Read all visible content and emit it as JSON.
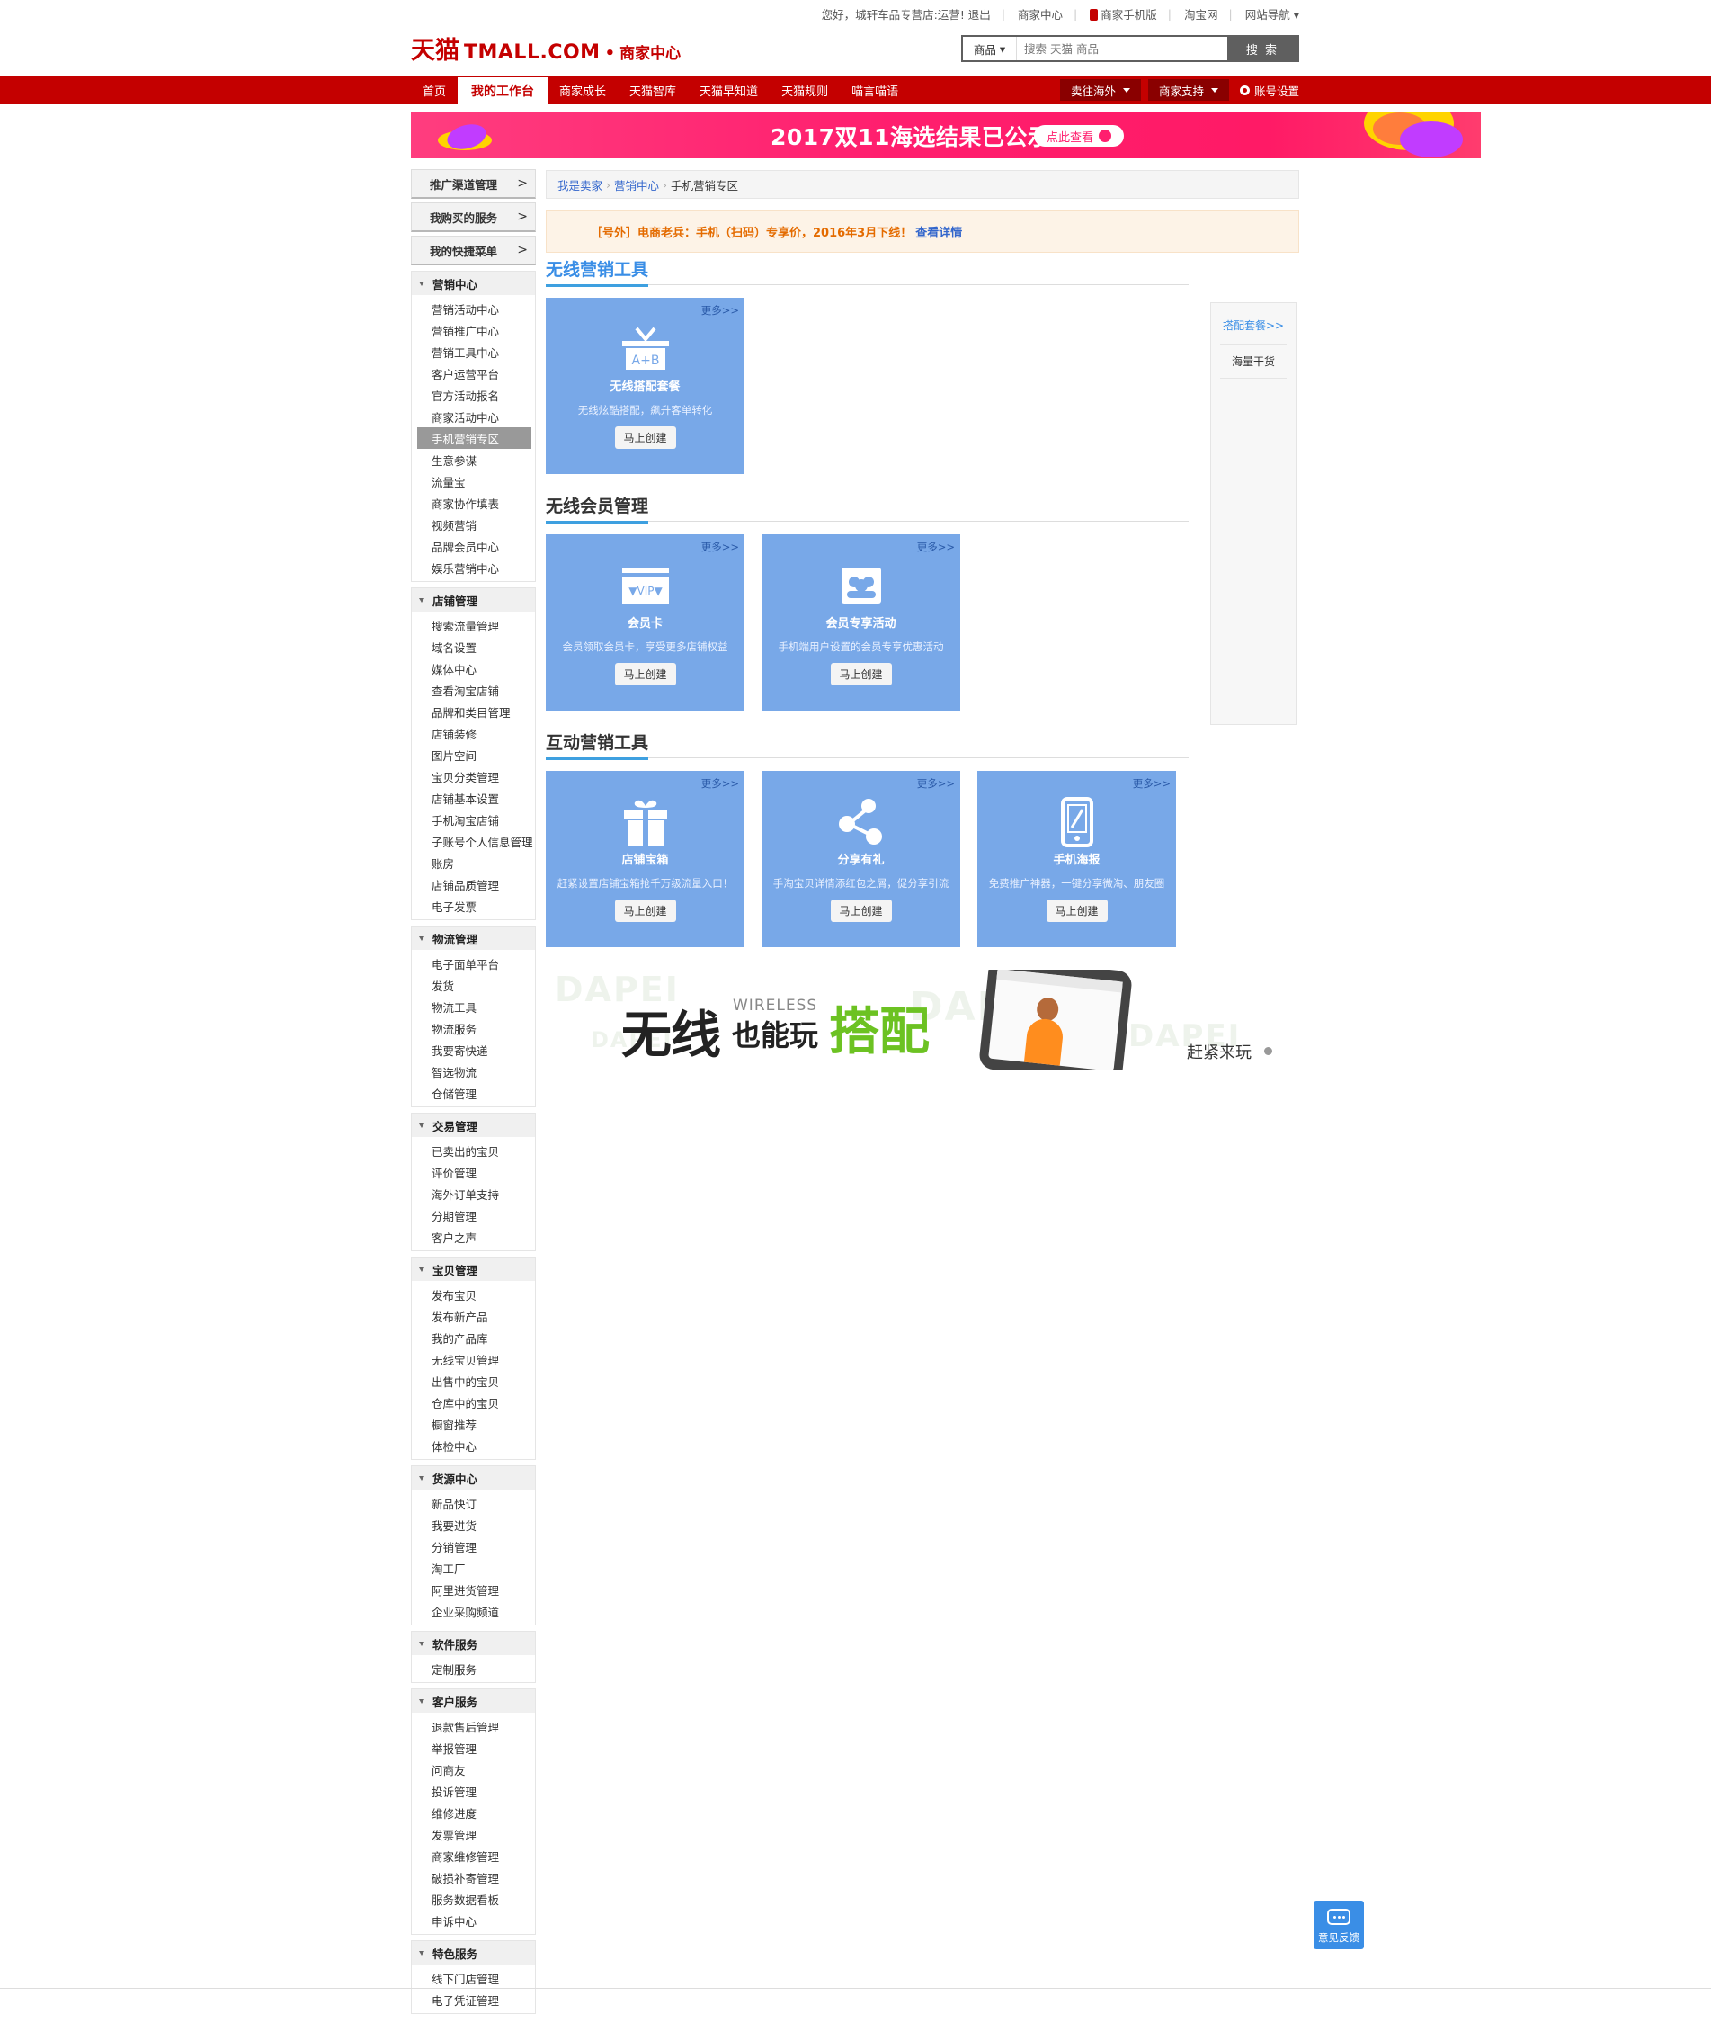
{
  "topbar": {
    "greeting": "您好，城轩车品专营店:运营! 退出",
    "merchant_center": "商家中心",
    "mobile_version": "商家手机版",
    "taobao": "淘宝网",
    "site_nav": "网站导航"
  },
  "header": {
    "logo_cn": "天猫",
    "logo_en": "TMALL.COM",
    "logo_dot": "•",
    "logo_sub": "商家中心",
    "search_category": "商品",
    "search_placeholder": "搜索 天猫 商品",
    "search_button": "搜 索"
  },
  "nav": {
    "items": [
      "首页",
      "我的工作台",
      "商家成长",
      "天猫智库",
      "天猫早知道",
      "天猫规则",
      "喵言喵语"
    ],
    "active_index": 1,
    "sell_abroad": "卖往海外",
    "merchant_support": "商家支持",
    "account_settings": "账号设置"
  },
  "banner": {
    "title": "2017双11海选结果已公示",
    "cta": "点此查看"
  },
  "sidebar": {
    "top_items": [
      "推广渠道管理",
      "我购买的服务",
      "我的快捷菜单"
    ],
    "groups": [
      {
        "title": "营销中心",
        "links": [
          "营销活动中心",
          "营销推广中心",
          "营销工具中心",
          "客户运营平台",
          "官方活动报名",
          "商家活动中心",
          "手机营销专区",
          "生意参谋",
          "流量宝",
          "商家协作填表",
          "视频营销",
          "品牌会员中心",
          "娱乐营销中心"
        ],
        "active": 6
      },
      {
        "title": "店铺管理",
        "links": [
          "搜索流量管理",
          "域名设置",
          "媒体中心",
          "查看淘宝店铺",
          "品牌和类目管理",
          "店铺装修",
          "图片空间",
          "宝贝分类管理",
          "店铺基本设置",
          "手机淘宝店铺",
          "子账号个人信息管理",
          "账房",
          "店铺品质管理",
          "电子发票"
        ]
      },
      {
        "title": "物流管理",
        "links": [
          "电子面单平台",
          "发货",
          "物流工具",
          "物流服务",
          "我要寄快递",
          "智选物流",
          "仓储管理"
        ]
      },
      {
        "title": "交易管理",
        "links": [
          "已卖出的宝贝",
          "评价管理",
          "海外订单支持",
          "分期管理",
          "客户之声"
        ]
      },
      {
        "title": "宝贝管理",
        "links": [
          "发布宝贝",
          "发布新产品",
          "我的产品库",
          "无线宝贝管理",
          "出售中的宝贝",
          "仓库中的宝贝",
          "橱窗推荐",
          "体检中心"
        ]
      },
      {
        "title": "货源中心",
        "links": [
          "新品快订",
          "我要进货",
          "分销管理",
          "淘工厂",
          "阿里进货管理",
          "企业采购频道"
        ]
      },
      {
        "title": "软件服务",
        "links": [
          "定制服务"
        ]
      },
      {
        "title": "客户服务",
        "links": [
          "退款售后管理",
          "举报管理",
          "问商友",
          "投诉管理",
          "维修进度",
          "发票管理",
          "商家维修管理",
          "破损补寄管理",
          "服务数据看板",
          "申诉中心"
        ]
      },
      {
        "title": "特色服务",
        "links": [
          "线下门店管理",
          "电子凭证管理"
        ]
      }
    ]
  },
  "breadcrumb": {
    "seller": "我是卖家",
    "marketing": "营销中心",
    "current": "手机营销专区"
  },
  "notice": {
    "text": "［号外］电商老兵：手机（扫码）专享价，2016年3月下线！",
    "link": "查看详情"
  },
  "sections": [
    {
      "title": "无线营销工具",
      "cards": [
        {
          "name": "无线搭配套餐",
          "desc": "无线炫酷搭配，飙升客单转化",
          "button": "马上创建",
          "more": "更多>>",
          "icon": "ab-box-icon"
        }
      ]
    },
    {
      "title": "无线会员管理",
      "cards": [
        {
          "name": "会员卡",
          "desc": "会员领取会员卡，享受更多店铺权益",
          "button": "马上创建",
          "more": "更多>>",
          "icon": "vip-card-icon"
        },
        {
          "name": "会员专享活动",
          "desc": "手机端用户设置的会员专享优惠活动",
          "button": "马上创建",
          "more": "更多>>",
          "icon": "members-icon"
        }
      ]
    },
    {
      "title": "互动营销工具",
      "cards": [
        {
          "name": "店铺宝箱",
          "desc": "赶紧设置店铺宝箱抢千万级流量入口！",
          "button": "马上创建",
          "more": "更多>>",
          "icon": "gift-box-icon"
        },
        {
          "name": "分享有礼",
          "desc": "手淘宝贝详情添红包之屑，促分享引流",
          "button": "马上创建",
          "more": "更多>>",
          "icon": "share-icon"
        },
        {
          "name": "手机海报",
          "desc": "免费推广神器，一键分享微淘、朋友圈",
          "button": "马上创建",
          "more": "更多>>",
          "icon": "phone-poster-icon"
        }
      ]
    }
  ],
  "right_panel": {
    "link": "搭配套餐>>",
    "item": "海量干货"
  },
  "promo": {
    "ghost1": "DAPEI",
    "ghost2": "DAPEI",
    "ghost3": "DAPEI",
    "ghost4": "DAPEI",
    "wireless": "WIRELESS",
    "line1": "无线",
    "line2": "也能玩",
    "line3": "搭配",
    "hint": "赶紧来玩"
  },
  "feedback": {
    "label": "意见反馈"
  },
  "colors": {
    "brand_red": "#c40000",
    "card_blue": "#78a8e8",
    "accent_blue": "#3a8ee6"
  }
}
